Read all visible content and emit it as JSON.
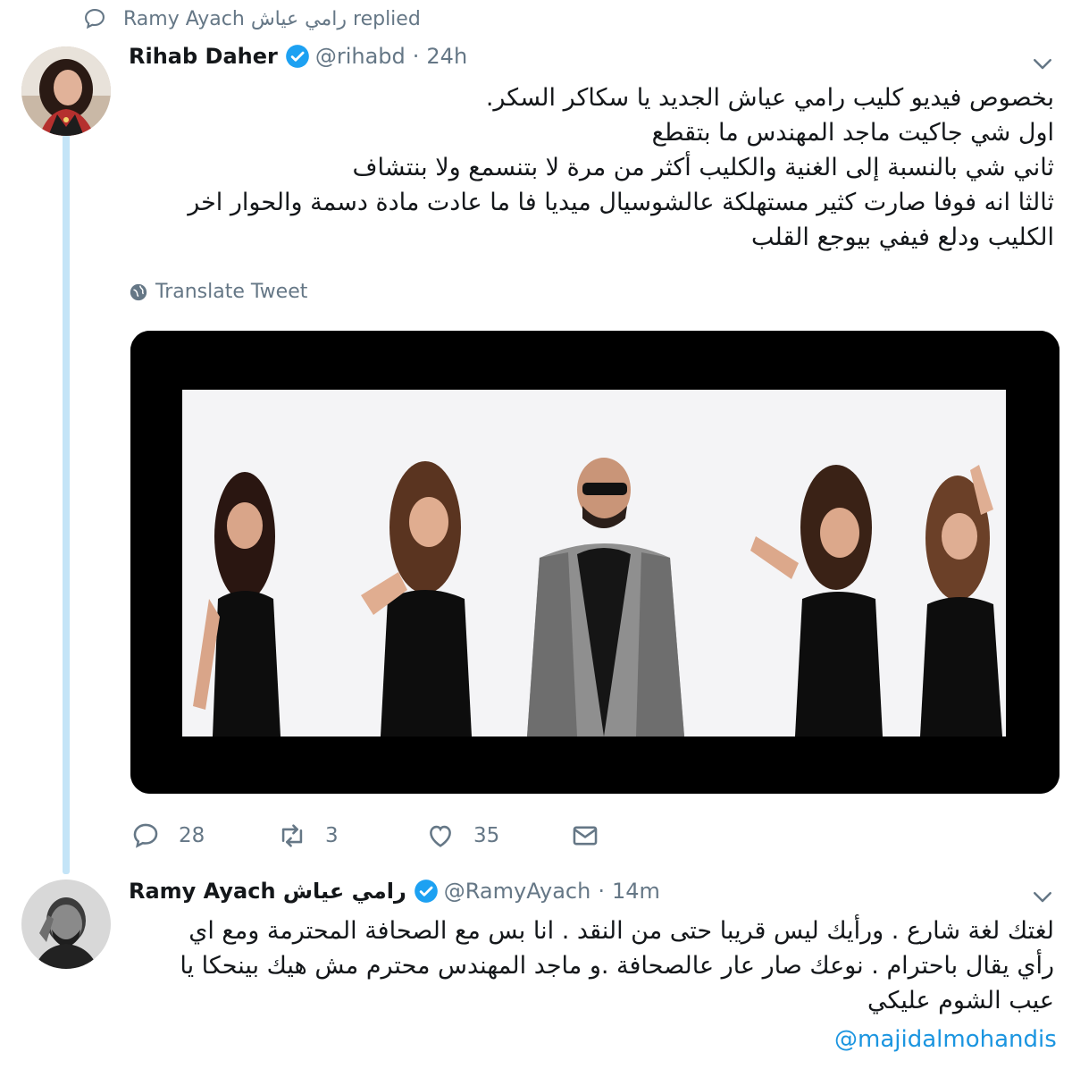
{
  "context": {
    "icon": "reply-icon",
    "text": "Ramy Ayach رامي عياش replied"
  },
  "tweet1": {
    "name": "Rihab Daher",
    "verified": true,
    "handle": "@rihabd",
    "separator": "·",
    "time": "24h",
    "text": "بخصوص فيديو كليب رامي عياش الجديد يا سكاكر السكر.\nاول شي جاكيت ماجد المهندس ما بتقطع\nثاني شي بالنسبة إلى  الغنية والكليب أكثر من مرة لا بتنسمع ولا بنتشاف\nثالثا انه فوفا صارت كثير مستهلكة عالشوسيال ميديا فا ما عادت مادة دسمة   والحوار اخر\nالكليب  ودلع فيفي بيوجع القلب",
    "translate_label": "Translate Tweet",
    "actions": {
      "replies": "28",
      "retweets": "3",
      "likes": "35"
    }
  },
  "tweet2": {
    "name": "Ramy Ayach رامي عياش",
    "verified": true,
    "handle": "@RamyAyach",
    "separator": "·",
    "time": "14m",
    "text": "لغتك لغة شارع . ورأيك ليس قريبا حتى من النقد . انا بس مع الصحافة المحترمة ومع اي\nرأي يقال باحترام . نوعك صار عار عالصحافة .و ماجد المهندس محترم مش هيك بينحكا يا\nعيب الشوم عليكي",
    "mention": "@majidalmohandis"
  },
  "colors": {
    "accent": "#1da1f2",
    "link": "#1b95e0",
    "muted": "#657786",
    "thread": "#c4e4f7"
  }
}
